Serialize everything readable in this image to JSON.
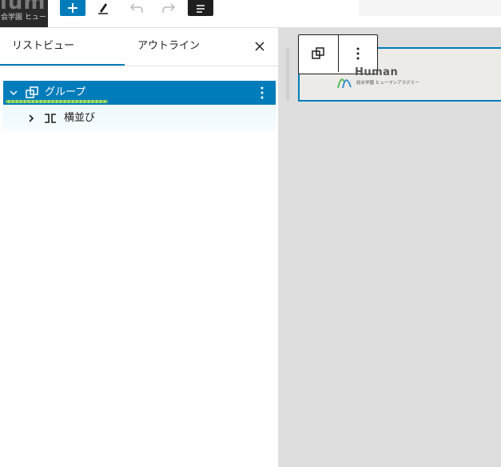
{
  "app": {
    "site_logo": {
      "big": "lum",
      "small": "会学園 ヒュー"
    }
  },
  "toolbar": {
    "add_label": "+",
    "icons": [
      "plus-icon",
      "pencil-icon",
      "undo-icon",
      "redo-icon",
      "list-view-icon"
    ]
  },
  "panel": {
    "tabs": [
      {
        "label": "リストビュー",
        "active": true
      },
      {
        "label": "アウトライン",
        "active": false
      }
    ],
    "close_icon": "close-icon",
    "tree": [
      {
        "label": "グループ",
        "icon": "group-icon",
        "selected": true,
        "expanded": true,
        "level": 1
      },
      {
        "label": "横並び",
        "icon": "row-icon",
        "selected": false,
        "expanded": false,
        "level": 2
      }
    ]
  },
  "canvas": {
    "block_toolbar": {
      "icons": [
        "group-icon",
        "more-vertical-icon"
      ]
    },
    "brand": {
      "word": "Human",
      "subtitle": "総合学園 ヒューマンアカデミー"
    }
  },
  "colors": {
    "accent": "#007cba",
    "dark": "#1e1e1e",
    "canvas": "#dddddd",
    "highlight": "#8bd24a"
  }
}
